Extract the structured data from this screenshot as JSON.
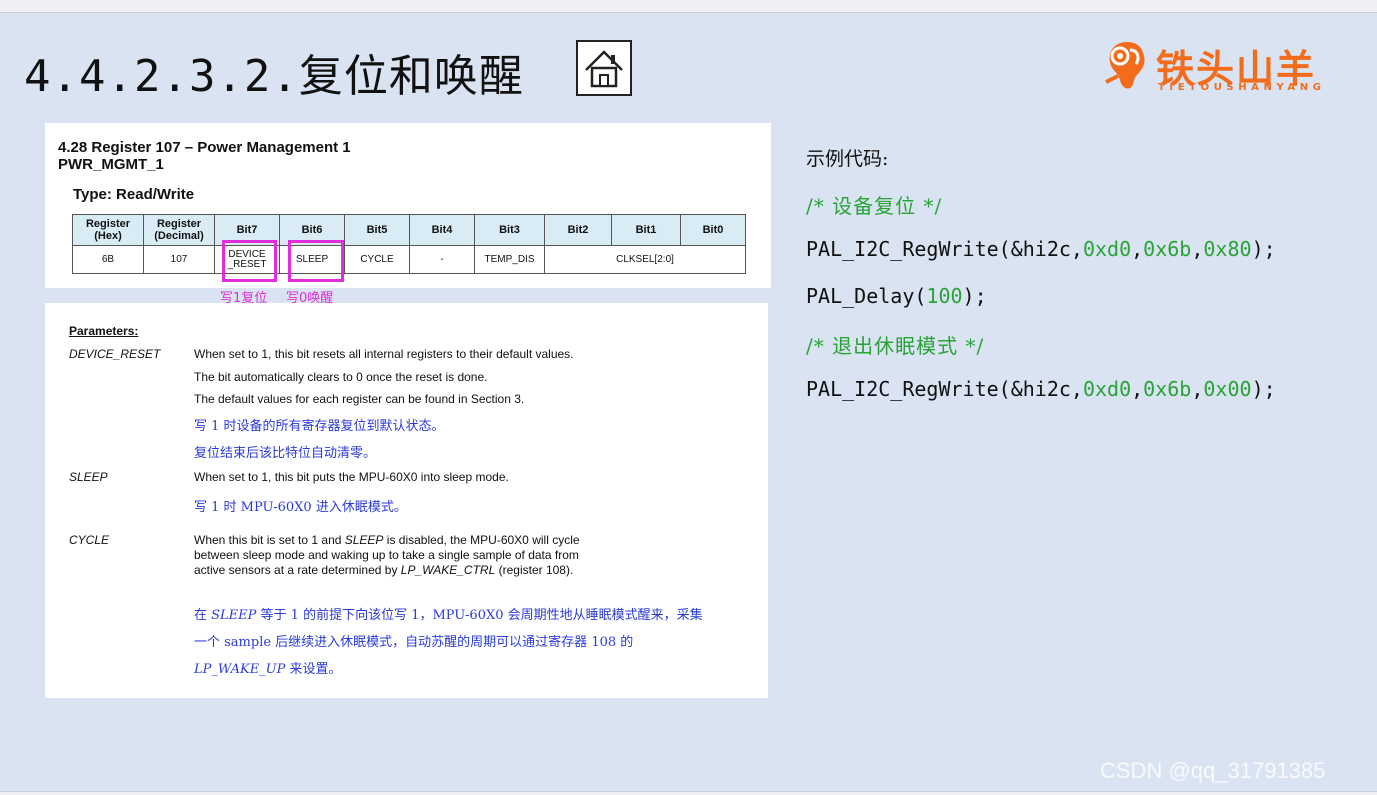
{
  "slide": {
    "title": "4.4.2.3.2.复位和唤醒",
    "home_icon": "home-icon",
    "logo": {
      "cn": "铁头山羊",
      "en": "TIETOUSHANYANG",
      "icon": "ram-head-icon",
      "color": "#f36c1c"
    }
  },
  "register": {
    "heading": "4.28 Register 107 – Power Management 1",
    "subheading": "PWR_MGMT_1",
    "type_label": "Type: Read/Write",
    "headers": [
      "Register (Hex)",
      "Register (Decimal)",
      "Bit7",
      "Bit6",
      "Bit5",
      "Bit4",
      "Bit3",
      "Bit2",
      "Bit1",
      "Bit0"
    ],
    "row": {
      "hex": "6B",
      "decimal": "107",
      "bit7": "DEVICE _RESET",
      "bit6": "SLEEP",
      "bit5": "CYCLE",
      "bit4": "-",
      "bit3": "TEMP_DIS",
      "bit2_0": "CLKSEL[2:0]"
    },
    "annotations": {
      "reset": "写1复位",
      "wake": "写0唤醒",
      "color": "#e22ddd"
    }
  },
  "params": {
    "title": "Parameters:",
    "device_reset": {
      "name": "DEVICE_RESET",
      "lines": [
        "When set to 1, this bit resets all internal registers to their default values.",
        "The bit automatically clears to 0 once the reset is done.",
        "The default values for each register can be found in Section 3."
      ],
      "cn": [
        "写 1 时设备的所有寄存器复位到默认状态。",
        "复位结束后该比特位自动清零。"
      ]
    },
    "sleep": {
      "name": "SLEEP",
      "line": "When set to 1, this bit puts the MPU-60X0 into sleep mode.",
      "cn": "写 1 时 MPU-60X0 进入休眠模式。"
    },
    "cycle": {
      "name": "CYCLE",
      "l1_a": "When this bit is set to 1 and ",
      "l1_b": "SLEEP",
      "l1_c": " is disabled, the MPU-60X0 will cycle",
      "l2": "between sleep mode and waking up to take a single sample of data from",
      "l3_a": "active sensors at a rate determined by ",
      "l3_b": "LP_WAKE_CTRL",
      "l3_c": " (register 108).",
      "cn1_a": "在 ",
      "cn1_b": "SLEEP",
      "cn1_c": " 等于 1 的前提下向该位写 1，MPU-60X0 会周期性地从睡眠模式醒来，采集",
      "cn2": "一个 sample 后继续进入休眠模式，自动苏醒的周期可以通过寄存器 108 的",
      "cn3_a": "LP_WAKE_UP",
      "cn3_b": " 来设置。"
    }
  },
  "code": {
    "caption": "示例代码:",
    "comment1": "/* 设备复位 */",
    "call1": {
      "fn": "PAL_I2C_RegWrite(&hi2c,",
      "a1": "0xd0",
      "a2": "0x6b",
      "a3": "0x80",
      "end": ");"
    },
    "delay": {
      "fn": "PAL_Delay(",
      "arg": "100",
      "end": ");"
    },
    "comment2": "/* 退出休眠模式 */",
    "call2": {
      "fn": "PAL_I2C_RegWrite(&hi2c,",
      "a1": "0xd0",
      "a2": "0x6b",
      "a3": "0x00",
      "end": ");"
    },
    "comma": ",",
    "comment_color": "#29a337"
  },
  "watermark": "CSDN @qq_31791385"
}
